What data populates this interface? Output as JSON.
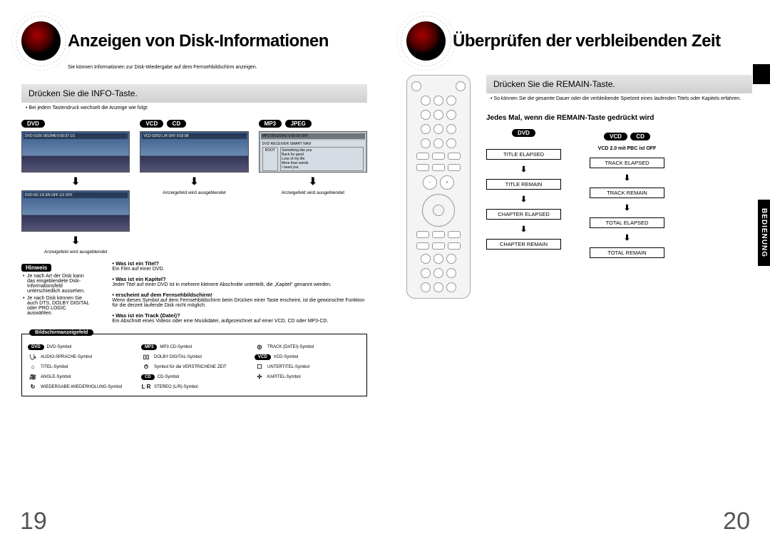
{
  "left": {
    "title": "Anzeigen von Disk-Informationen",
    "subtitle": "Sie können Informationen zur Disk-Wiedergabe auf dem Fernsehbildschirm anzeigen.",
    "instruction": "Drücken Sie die INFO-Taste.",
    "instr_note": "Bei jedem Tastendruck wechselt die Anzeige wie folgt:",
    "badges": {
      "dvd": "DVD",
      "vcd": "VCD",
      "cd": "CD",
      "mp3": "MP3",
      "jpeg": "JPEG"
    },
    "dvd_osd1": "DVD  01/01  001/040  0:00:37  1/1",
    "dvd_osd2": "DVD  KD 1/6  EN  OFF 1/1  OFF",
    "vcd_osd": "VCD  02/02  L/R  OFF  0:02:08",
    "mp3_header": "MP3  0001/0042  0:00:08  OFF",
    "mp3_title": "DVD RECEIVER  SMART NAVI",
    "mp3_root": "ROOT",
    "mp3_items": [
      "Something like you",
      "Back for good",
      "Love of my life",
      "More than words",
      "I need you"
    ],
    "caption_hidden": "Anzeigefeld wird ausgeblendet",
    "hinweis_label": "Hinweis",
    "notes": [
      "Je nach Art der Disk kann das eingeblendete Disk-Informationsfeld unterschiedlich aussehen.",
      "Je nach Disk können Sie auch DTS, DOLBY DIGITAL oder PRO LOGIC auswählen."
    ],
    "glossary": [
      {
        "term": "Was ist ein Titel?",
        "desc": "Ein Film auf einer DVD."
      },
      {
        "term": "Was ist ein Kapitel?",
        "desc": "Jeder Titel auf einer DVD ist in mehrere kleinere Abschnitte unterteilt, die „Kapitel“ genannt werden."
      },
      {
        "term": "erscheint auf dem Fernsehbildschirm!",
        "desc": "Wenn dieses Symbol auf dem Fernsehbildschirm beim Drücken einer Taste erscheint, ist die gewünschte Funktion für die derzeit laufende Disk nicht möglich."
      },
      {
        "term": "Was ist ein Track (Datei)?",
        "desc": "Ein Abschnitt eines Videos oder eine Musikdatei, aufgezeichnet auf einer VCD, CD oder MP3-CD."
      }
    ],
    "legend_label": "Bildschirmanzeigefeld",
    "legend": [
      {
        "sym": "DVD",
        "pill": true,
        "text": "DVD-Symbol"
      },
      {
        "sym": "MP3",
        "pill": true,
        "text": "MP3 CD-Symbol"
      },
      {
        "sym": "◎",
        "text": "TRACK (DATEI)-Symbol"
      },
      {
        "sym": "🗣",
        "text": "AUDIO-SPRACHE-Symbol"
      },
      {
        "sym": "▯▯",
        "text": "DOLBY DIGITAL-Symbol"
      },
      {
        "sym": "VCD",
        "pill": true,
        "text": "VCD-Symbol"
      },
      {
        "sym": "⌂",
        "text": "TITEL-Symbol"
      },
      {
        "sym": "⏱",
        "text": "Symbol für die VERSTRICHENE ZEIT"
      },
      {
        "sym": "☐",
        "text": "UNTERTITEL-Symbol"
      },
      {
        "sym": "🎥",
        "text": "ANGLE-Symbol"
      },
      {
        "sym": "CD",
        "pill": true,
        "text": "CD-Symbol"
      },
      {
        "sym": "✣",
        "text": "KAPITEL-Symbol"
      },
      {
        "sym": "↻",
        "text": "WIEDERGABE-WIEDERHOLUNG-Symbol"
      },
      {
        "sym": "L R",
        "text": "STEREO (L/R)-Symbol"
      }
    ],
    "pagenum": "19"
  },
  "right": {
    "title": "Überprüfen der verbleibenden Zeit",
    "instruction": "Drücken Sie die REMAIN-Taste.",
    "instr_note": "So können Sie die gesamte Dauer oder die verbleibende Spielzeit eines laufenden Titels oder Kapitels erfahren.",
    "block_head": "Jedes Mal, wenn die REMAIN-Taste gedrückt wird",
    "dvd_badge": "DVD",
    "vcd_badge": "VCD",
    "cd_badge": "CD",
    "vcd_note": "VCD 2.0 mit PBC ist OFF",
    "dvd_states": [
      "TITLE ELAPSED",
      "TITLE REMAIN",
      "CHAPTER ELAPSED",
      "CHAPTER REMAIN"
    ],
    "vcd_states": [
      "TRACK ELAPSED",
      "TRACK REMAIN",
      "TOTAL ELAPSED",
      "TOTAL REMAIN"
    ],
    "side_tab": "BEDIENUNG",
    "pagenum": "20"
  }
}
